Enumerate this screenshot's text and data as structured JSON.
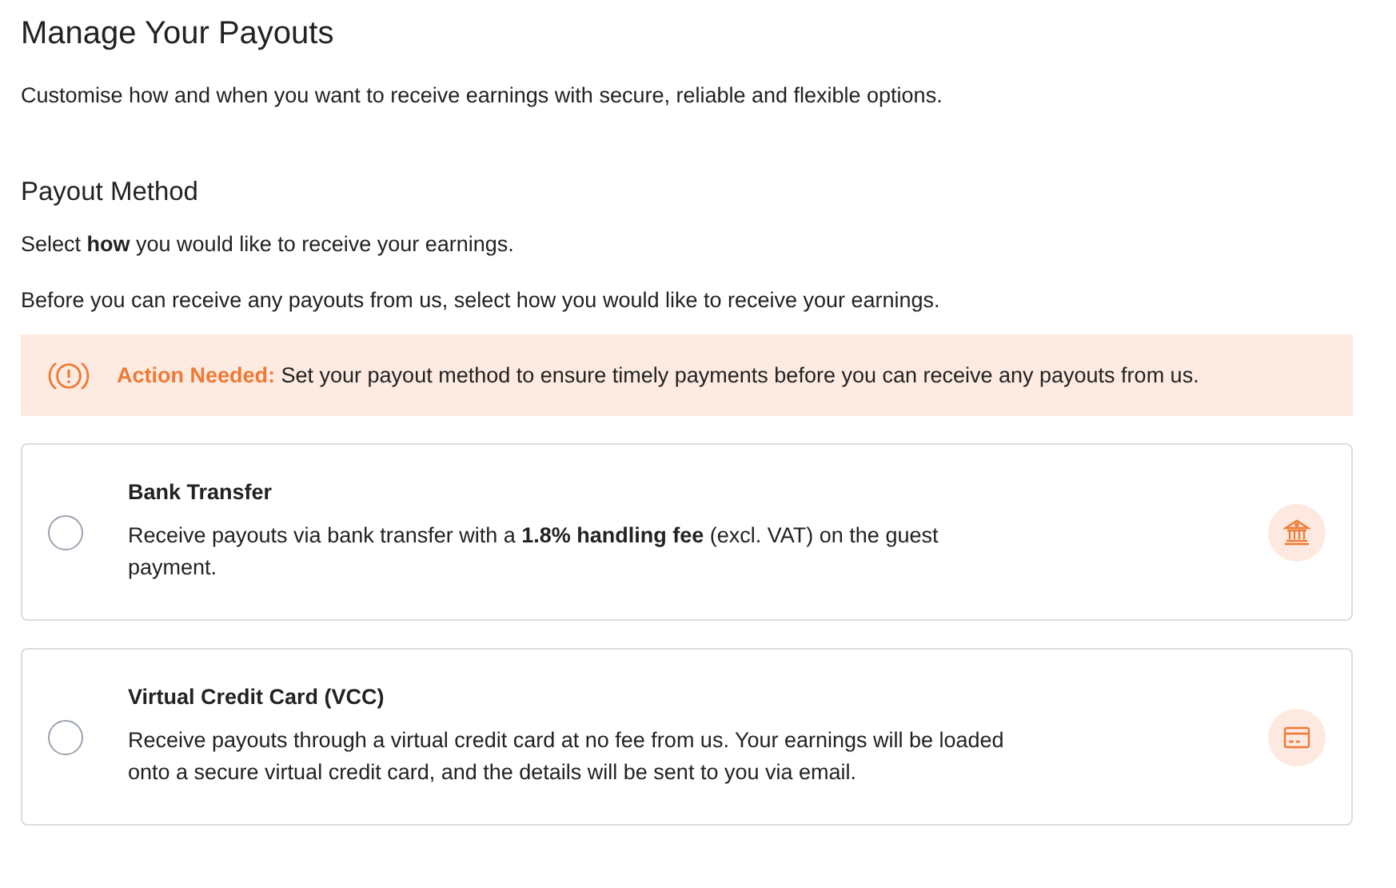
{
  "title": "Manage Your Payouts",
  "subtitle": "Customise how and when you want to receive earnings with secure, reliable and flexible options.",
  "section": {
    "heading": "Payout Method",
    "lines": [
      "Select **how** you would like to receive your earnings.",
      "Before you can receive any payouts from us, select how you would like to receive your earnings."
    ]
  },
  "alert": {
    "text": "**Action Needed:** Set your payout method to ensure timely payments before you can receive any payouts from us."
  },
  "options": [
    {
      "kind": "bank",
      "title": "Bank Transfer",
      "description": "Receive payouts via bank transfer with a **1.8% handling fee** (excl. VAT) on the guest payment.",
      "selected": false
    },
    {
      "kind": "card",
      "title": "Virtual Credit Card (VCC)",
      "description": "Receive payouts through a virtual credit card at no fee from us. Your earnings will be loaded onto a secure virtual credit card, and the details will be sent to you via email.",
      "selected": false
    }
  ]
}
